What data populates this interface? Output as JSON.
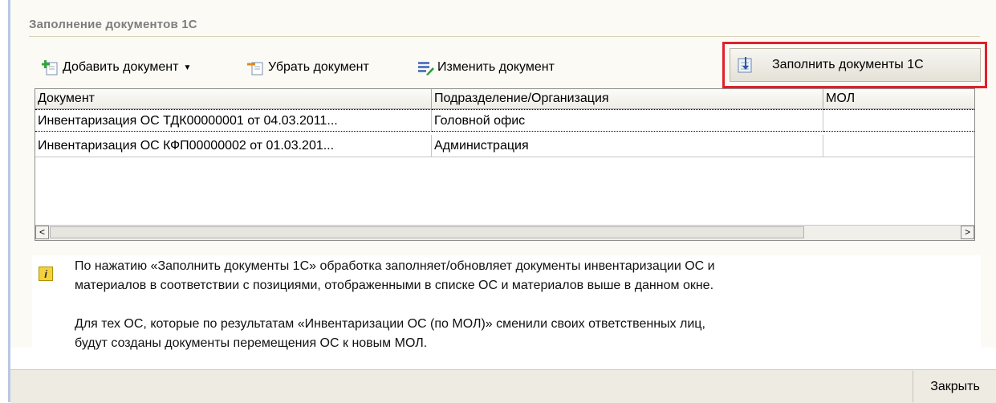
{
  "group": {
    "title": "Заполнение документов 1С"
  },
  "toolbar": {
    "add_label": "Добавить документ",
    "remove_label": "Убрать документ",
    "edit_label": "Изменить документ",
    "fill_label": "Заполнить документы 1С"
  },
  "table": {
    "headers": [
      "Документ",
      "Подразделение/Организация",
      "МОЛ"
    ],
    "rows": [
      [
        "Инвентаризация ОС ТДК00000001 от 04.03.2011...",
        "Головной офис",
        ""
      ],
      [
        "Инвентаризация ОС КФП00000002 от 01.03.201...",
        "Администрация",
        ""
      ]
    ]
  },
  "info": {
    "p1_line1": "По нажатию «Заполнить документы 1С» обработка заполняет/обновляет документы инвентаризации ОС и",
    "p1_line2": "материалов в соответствии с позициями, отображенными в списке ОС и материалов выше в данном окне.",
    "p2_line1": "Для тех ОС, которые по результатам «Инвентаризации ОС (по МОЛ)» сменили своих ответственных лиц,",
    "p2_line2": "будут созданы документы перемещения ОС к новым МОЛ."
  },
  "footer": {
    "close_label": "Закрыть"
  },
  "colors": {
    "highlight_frame": "#e0202c",
    "info_icon": "#f4d23c"
  }
}
